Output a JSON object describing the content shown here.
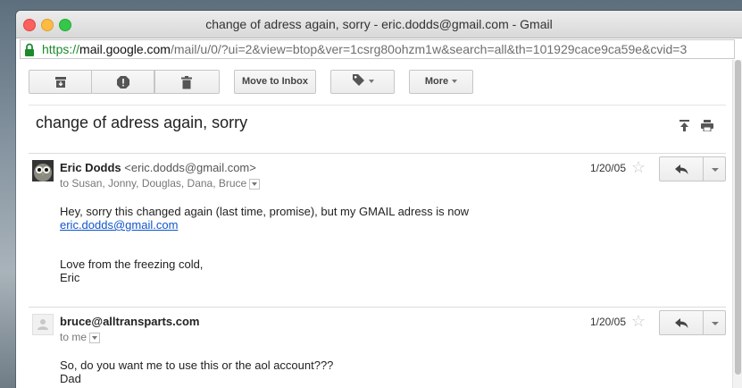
{
  "window": {
    "title": "change of adress again, sorry - eric.dodds@gmail.com - Gmail"
  },
  "url": {
    "scheme": "https://",
    "host": "mail.google.com",
    "path": "/mail/u/0/?ui=2&view=btop&ver=1csrg80ohzm1w&search=all&th=101929cace9ca59e&cvid=3"
  },
  "toolbar": {
    "archive_icon": "archive-icon",
    "spam_icon": "report-spam-icon",
    "delete_icon": "trash-icon",
    "move_to_inbox_label": "Move to Inbox",
    "labels_icon": "label-tag-icon",
    "more_label": "More"
  },
  "thread": {
    "subject": "change of adress again, sorry",
    "messages": [
      {
        "sender_name": "Eric Dodds",
        "sender_email": "<eric.dodds@gmail.com>",
        "to": "to Susan, Jonny, Douglas, Dana, Bruce",
        "date": "1/20/05",
        "body_line1": "Hey, sorry this changed again (last time, promise), but my GMAIL adress is now",
        "body_link": "eric.dodds@gmail.com",
        "body_line3": "Love from the freezing cold,",
        "body_line4": "Eric"
      },
      {
        "sender_name": "bruce@alltransparts.com",
        "to": "to me",
        "date": "1/20/05",
        "body_line1": "So, do you want me to use this or the aol account???",
        "body_line2": "Dad",
        "body_line3": ">"
      }
    ]
  },
  "colors": {
    "link": "#1155cc",
    "secure_green": "#1c8b2c"
  }
}
